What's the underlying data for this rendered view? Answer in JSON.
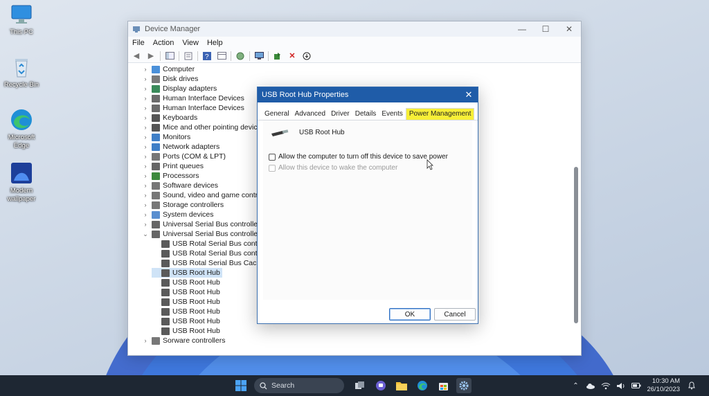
{
  "desktop": {
    "icons": [
      {
        "label": "This PC",
        "icon": "monitor-icon"
      },
      {
        "label": "Recycle Bin",
        "icon": "recycle-bin-icon"
      },
      {
        "label": "Microsoft Edge",
        "icon": "edge-icon"
      },
      {
        "label": "Modern wallpaper",
        "icon": "wallpaper-icon"
      }
    ]
  },
  "window": {
    "title": "Device Manager",
    "controls": {
      "minimize": "—",
      "maximize": "☐",
      "close": "✕"
    },
    "menu": [
      "File",
      "Action",
      "View",
      "Help"
    ],
    "tree": [
      {
        "label": "Computer",
        "color": "#4a90d9"
      },
      {
        "label": "Disk drives",
        "color": "#7a7a7a"
      },
      {
        "label": "Display adapters",
        "color": "#3a8a5a"
      },
      {
        "label": "Human Interface Devices",
        "color": "#6b6b6b"
      },
      {
        "label": "Human Interface Devices",
        "color": "#6b6b6b"
      },
      {
        "label": "Keyboards",
        "color": "#555555"
      },
      {
        "label": "Mice and other pointing devices",
        "color": "#555555"
      },
      {
        "label": "Monitors",
        "color": "#3f7fc7"
      },
      {
        "label": "Network adapters",
        "color": "#3f7fc7"
      },
      {
        "label": "Ports (COM & LPT)",
        "color": "#777777"
      },
      {
        "label": "Print queues",
        "color": "#666666"
      },
      {
        "label": "Processors",
        "color": "#3d8a3d"
      },
      {
        "label": "Software devices",
        "color": "#777777"
      },
      {
        "label": "Sound, video and game controllers",
        "color": "#777777"
      },
      {
        "label": "Storage controllers",
        "color": "#777777"
      },
      {
        "label": "System devices",
        "color": "#5a8fd0"
      },
      {
        "label": "Universal Serial Bus controllers",
        "color": "#666666"
      },
      {
        "label": "Universal Serial Bus controllers",
        "color": "#666666"
      }
    ],
    "usb_children": [
      "USB Rotal Serial Bus controller",
      "USB Rotal Serial Bus controller",
      "USB Rotal Serial Bus Cache",
      "USB Root Hub",
      "USB Root Hub",
      "USB Root Hub",
      "USB Root Hub",
      "USB Root Hub",
      "USB Root Hub",
      "USB Root Hub"
    ],
    "selected_child_index": 3,
    "last_partial": "Sorware controllers"
  },
  "dialog": {
    "title": "USB Root Hub Properties",
    "tabs": [
      "General",
      "Advanced",
      "Driver",
      "Details",
      "Events",
      "Power Management"
    ],
    "active_tab": "Power Management",
    "active_tab_highlight": "#f7ef37",
    "device_name": "USB Root Hub",
    "options": [
      {
        "label": "Allow the computer to turn off this device to save power",
        "checked": false,
        "enabled": true
      },
      {
        "label": "Allow this device to wake the computer",
        "checked": false,
        "enabled": false
      }
    ],
    "ok_label": "OK",
    "cancel_label": "Cancel"
  },
  "taskbar": {
    "search_placeholder": "Search",
    "time": "10:30 AM",
    "date": "26/10/2023",
    "accent": "#1e2733"
  }
}
